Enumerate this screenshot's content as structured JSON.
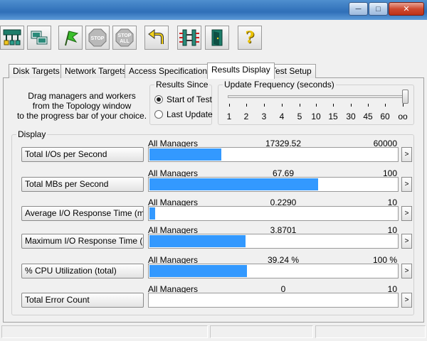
{
  "window": {
    "minimize_glyph": "─",
    "maximize_glyph": "□",
    "close_glyph": "✕"
  },
  "toolbar": {
    "icons": [
      "topology-icon",
      "new-manager-icon",
      "start-tests-icon",
      "stop-icon",
      "stop-all-icon",
      "reset-workers-icon",
      "disconnect-managers-icon",
      "exit-icon",
      "help-icon"
    ],
    "stop_label": "STOP",
    "stop_all_line1": "STOP",
    "stop_all_line2": "ALL",
    "help_glyph": "?"
  },
  "tabs": [
    {
      "label": "Disk Targets"
    },
    {
      "label": "Network Targets"
    },
    {
      "label": "Access Specifications"
    },
    {
      "label": "Results Display",
      "active": true
    },
    {
      "label": "Test Setup"
    }
  ],
  "instruction": {
    "line1": "Drag managers and workers",
    "line2": "from the Topology window",
    "line3": "to the progress bar of your choice."
  },
  "results_since": {
    "legend": "Results Since",
    "options": [
      {
        "label": "Start of Test",
        "selected": true
      },
      {
        "label": "Last Update",
        "selected": false
      }
    ]
  },
  "update_frequency": {
    "legend": "Update Frequency (seconds)",
    "ticks": [
      "1",
      "2",
      "3",
      "4",
      "5",
      "10",
      "15",
      "30",
      "45",
      "60",
      "oo"
    ],
    "selected": "oo"
  },
  "display": {
    "legend": "Display",
    "arrow_glyph": ">",
    "rows": [
      {
        "button": "Total I/Os per Second",
        "manager": "All Managers",
        "value": "17329.52",
        "max": "60000",
        "fill": 0.2888
      },
      {
        "button": "Total MBs per Second",
        "manager": "All Managers",
        "value": "67.69",
        "max": "100",
        "fill": 0.6769
      },
      {
        "button": "Average I/O Response Time (ms)",
        "manager": "All Managers",
        "value": "0.2290",
        "max": "10",
        "fill": 0.0229
      },
      {
        "button": "Maximum I/O Response Time (ms)",
        "manager": "All Managers",
        "value": "3.8701",
        "max": "10",
        "fill": 0.387
      },
      {
        "button": "% CPU Utilization (total)",
        "manager": "All Managers",
        "value": "39.24 %",
        "max": "100 %",
        "fill": 0.3924
      },
      {
        "button": "Total Error Count",
        "manager": "All Managers",
        "value": "0",
        "max": "10",
        "fill": 0
      }
    ]
  },
  "colors": {
    "bar": "#3399ff",
    "titlebar": "#2f6fb8"
  }
}
